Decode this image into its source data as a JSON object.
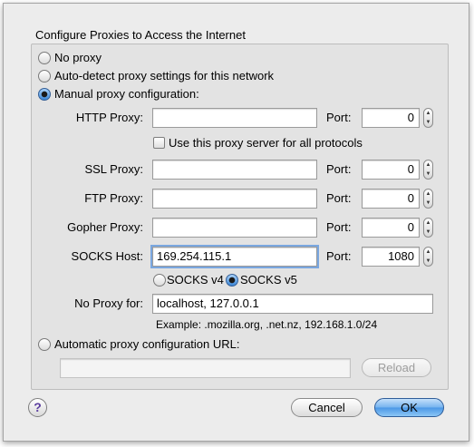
{
  "title": "Configure Proxies to Access the Internet",
  "mode_options": {
    "no_proxy": "No proxy",
    "auto_detect": "Auto-detect proxy settings for this network",
    "manual": "Manual proxy configuration:",
    "auto_url": "Automatic proxy configuration URL:"
  },
  "selected_mode": "manual",
  "port_label": "Port:",
  "http": {
    "label": "HTTP Proxy:",
    "value": "",
    "port": "0"
  },
  "use_for_all": {
    "label": "Use this proxy server for all protocols",
    "checked": false
  },
  "ssl": {
    "label": "SSL Proxy:",
    "value": "",
    "port": "0"
  },
  "ftp": {
    "label": "FTP Proxy:",
    "value": "",
    "port": "0"
  },
  "gopher": {
    "label": "Gopher Proxy:",
    "value": "",
    "port": "0"
  },
  "socks": {
    "label": "SOCKS Host:",
    "value": "169.254.115.1",
    "port": "1080"
  },
  "socks_version": {
    "v4": "SOCKS v4",
    "v5": "SOCKS v5",
    "selected": "v5"
  },
  "no_proxy_for": {
    "label": "No Proxy for:",
    "value": "localhost, 127.0.0.1"
  },
  "example": "Example: .mozilla.org, .net.nz, 192.168.1.0/24",
  "auto_url_value": "",
  "buttons": {
    "reload": "Reload",
    "cancel": "Cancel",
    "ok": "OK",
    "help": "?"
  },
  "icons": {
    "stepper": "stepper-arrows",
    "help": "question-mark-icon"
  }
}
